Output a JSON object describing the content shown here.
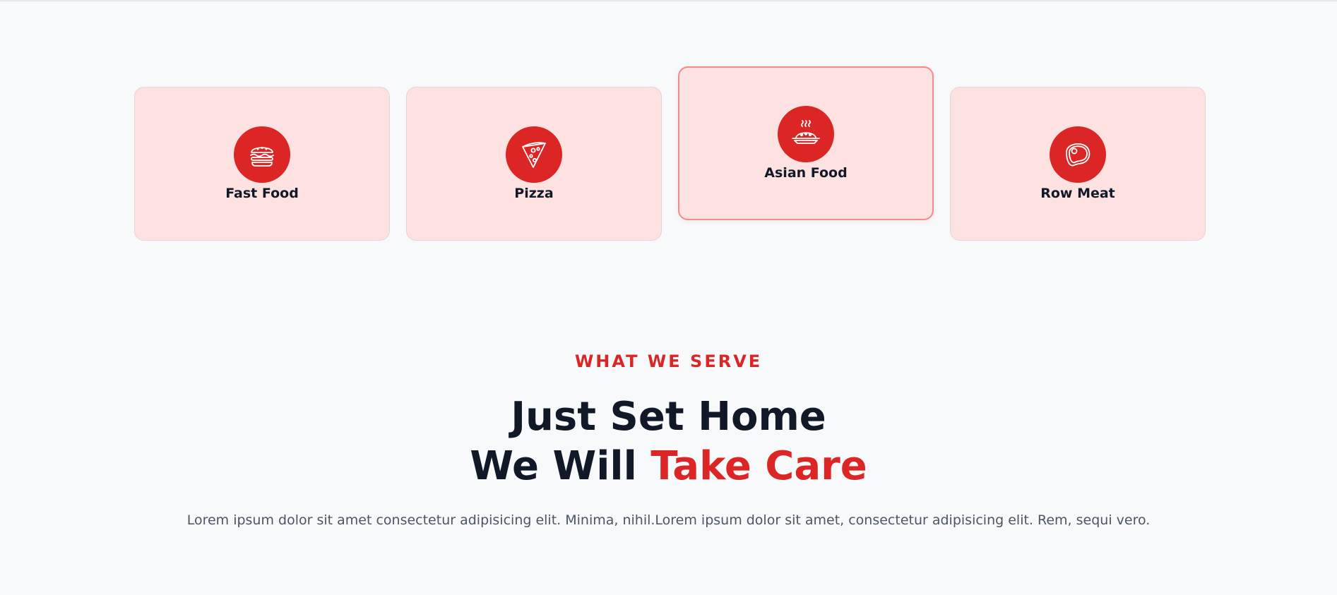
{
  "categories": [
    {
      "label": "Fast Food",
      "icon": "burger-icon",
      "active": false
    },
    {
      "label": "Pizza",
      "icon": "pizza-icon",
      "active": false
    },
    {
      "label": "Asian Food",
      "icon": "asian-food-icon",
      "active": true
    },
    {
      "label": "Row Meat",
      "icon": "steak-icon",
      "active": false
    }
  ],
  "section": {
    "eyebrow": "WHAT WE SERVE",
    "headline_line1": "Just Set Home",
    "headline_line2_prefix": "We Will ",
    "headline_line2_accent": "Take Care",
    "description": "Lorem ipsum dolor sit amet consectetur adipisicing elit. Minima, nihil.Lorem ipsum dolor sit amet, consectetur adipisicing elit. Rem, sequi vero."
  },
  "colors": {
    "accent": "#dc2626",
    "card_bg": "#fee2e2",
    "page_bg": "#f8f9fb",
    "heading": "#111827",
    "body_text": "#4b5563"
  }
}
